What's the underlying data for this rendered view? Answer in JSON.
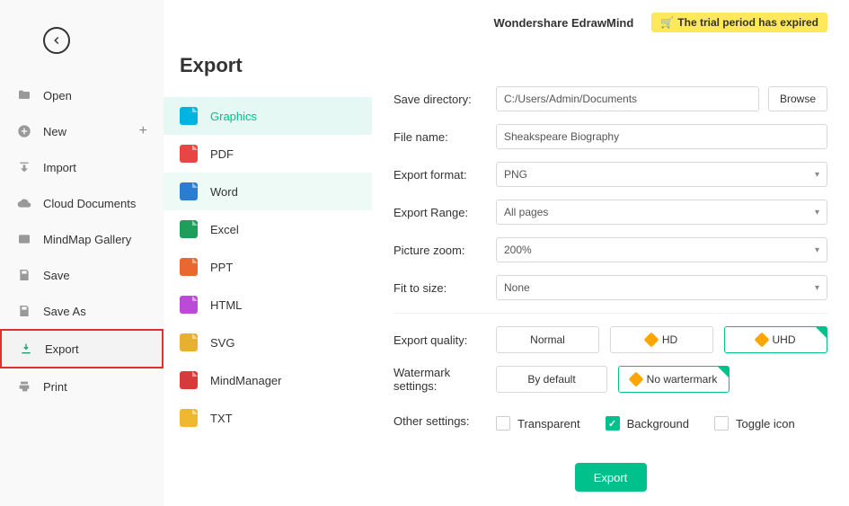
{
  "header": {
    "app_name": "Wondershare EdrawMind",
    "trial_text": "The trial period has expired"
  },
  "nav": {
    "open": "Open",
    "new": "New",
    "import": "Import",
    "cloud": "Cloud Documents",
    "gallery": "MindMap Gallery",
    "save": "Save",
    "saveas": "Save As",
    "export": "Export",
    "print": "Print"
  },
  "export_panel": {
    "title": "Export",
    "formats": {
      "graphics": "Graphics",
      "pdf": "PDF",
      "word": "Word",
      "excel": "Excel",
      "ppt": "PPT",
      "html": "HTML",
      "svg": "SVG",
      "mindmanager": "MindManager",
      "txt": "TXT"
    }
  },
  "form": {
    "save_dir_label": "Save directory:",
    "save_dir_value": "C:/Users/Admin/Documents",
    "browse": "Browse",
    "filename_label": "File name:",
    "filename_value": "Sheakspeare Biography",
    "format_label": "Export format:",
    "format_value": "PNG",
    "range_label": "Export Range:",
    "range_value": "All pages",
    "zoom_label": "Picture zoom:",
    "zoom_value": "200%",
    "fit_label": "Fit to size:",
    "fit_value": "None",
    "quality_label": "Export quality:",
    "quality_normal": "Normal",
    "quality_hd": "HD",
    "quality_uhd": "UHD",
    "watermark_label": "Watermark settings:",
    "watermark_default": "By default",
    "watermark_none": "No wartermark",
    "other_label": "Other settings:",
    "transparent": "Transparent",
    "background": "Background",
    "toggle_icon": "Toggle icon",
    "export_btn": "Export"
  }
}
